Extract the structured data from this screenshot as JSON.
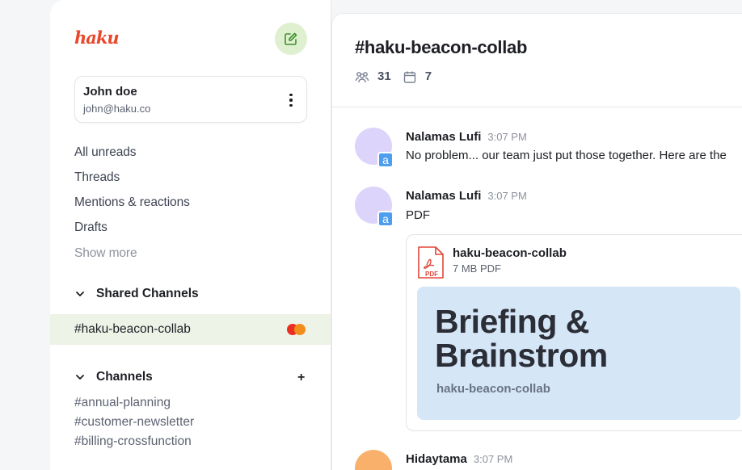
{
  "app": {
    "logo_text": "haku"
  },
  "icons": {
    "compose": "compose-icon",
    "more": "more-vertical-icon",
    "chevron": "chevron-down-icon",
    "add": "plus-icon",
    "members": "members-icon",
    "calendar": "calendar-icon",
    "pdf": "pdf-file-icon"
  },
  "colors": {
    "accent_red": "#e8472b",
    "compose_bg": "#dff0d0",
    "active_row_bg": "#eef3e8",
    "badge_red": "#eb2e22",
    "badge_orange": "#f28d1b",
    "preview_bg": "#d5e6f7",
    "avatar_badge_blue": "#4e9ef0"
  },
  "user": {
    "name": "John doe",
    "email": "john@haku.co"
  },
  "nav": {
    "items": [
      "All unreads",
      "Threads",
      "Mentions & reactions",
      "Drafts"
    ],
    "show_more": "Show more"
  },
  "shared_channels": {
    "title": "Shared Channels",
    "items": [
      {
        "label": "#haku-beacon-collab",
        "active": true
      }
    ]
  },
  "channels": {
    "title": "Channels",
    "add_label": "+",
    "items": [
      "#annual-planning",
      "#customer-newsletter",
      "#billing-crossfunction"
    ]
  },
  "channel_header": {
    "title": "#haku-beacon-collab",
    "members_count": "31",
    "events_count": "7"
  },
  "messages": [
    {
      "author": "Nalamas Lufi",
      "time": "3:07 PM",
      "badge": "a",
      "text": "No problem... our team just put those together. Here are the"
    },
    {
      "author": "Nalamas Lufi",
      "time": "3:07 PM",
      "badge": "a",
      "text": "PDF",
      "attachment": {
        "file_name": "haku-beacon-collab",
        "meta": "7 MB PDF",
        "pdf_label": "PDF",
        "preview_title_line1": "Briefing &",
        "preview_title_line2": "Brainstrom",
        "preview_subtitle": "haku-beacon-collab"
      }
    },
    {
      "author": "Hidaytama",
      "time": "3:07 PM"
    }
  ]
}
